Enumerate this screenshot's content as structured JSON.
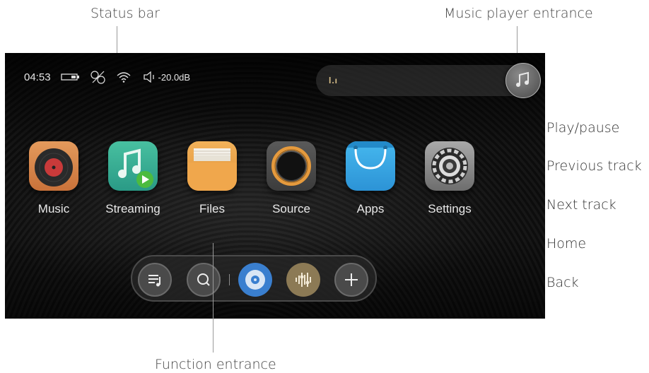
{
  "callouts": {
    "status_bar": "Status bar",
    "music_player_entrance": "Music player entrance",
    "function_entrance": "Function entrance",
    "play_pause": "Play/pause",
    "previous_track": "Previous track",
    "next_track": "Next track",
    "home": "Home",
    "back": "Back"
  },
  "status": {
    "time": "04:53",
    "volume": "-20.0dB"
  },
  "player": {
    "bars": "l.ı"
  },
  "apps": [
    {
      "label": "Music"
    },
    {
      "label": "Streaming"
    },
    {
      "label": "Files"
    },
    {
      "label": "Source"
    },
    {
      "label": "Apps"
    },
    {
      "label": "Settings"
    }
  ],
  "dock": [
    "playlist-icon",
    "search-icon",
    "cd-icon",
    "equalizer-icon",
    "add-icon"
  ]
}
